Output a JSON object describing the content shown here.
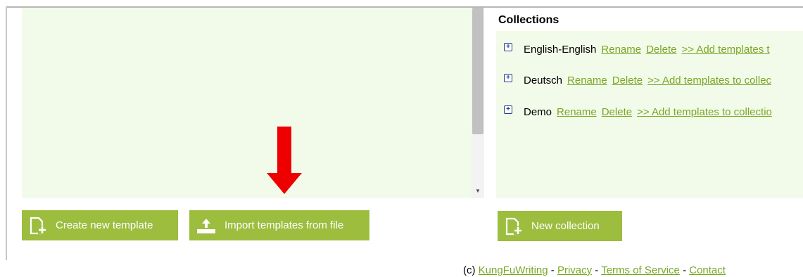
{
  "collections": {
    "title": "Collections",
    "items": [
      {
        "name": "English-English",
        "rename": "Rename",
        "delete": "Delete",
        "add": ">> Add templates t"
      },
      {
        "name": "Deutsch",
        "rename": "Rename",
        "delete": "Delete",
        "add": ">> Add templates to collec"
      },
      {
        "name": "Demo",
        "rename": "Rename",
        "delete": "Delete",
        "add": ">> Add templates to collectio"
      }
    ]
  },
  "buttons": {
    "create_template": "Create new template",
    "import_templates": "Import templates from file",
    "new_collection": "New collection"
  },
  "footer": {
    "copyright": "(c)",
    "kungfu": "KungFuWriting",
    "sep1": " - ",
    "privacy": "Privacy",
    "sep2": " - ",
    "terms": "Terms of Service",
    "sep3": " - ",
    "contact": "Contact"
  },
  "colors": {
    "accent_green": "#9dbd3f",
    "link_green": "#7aa625",
    "panel_bg": "#f2fbe9",
    "arrow_red": "#ee0000"
  },
  "icons": {
    "expand": "plus-box-icon",
    "new_doc": "new-document-icon",
    "upload": "upload-icon",
    "annotation": "red-down-arrow"
  }
}
